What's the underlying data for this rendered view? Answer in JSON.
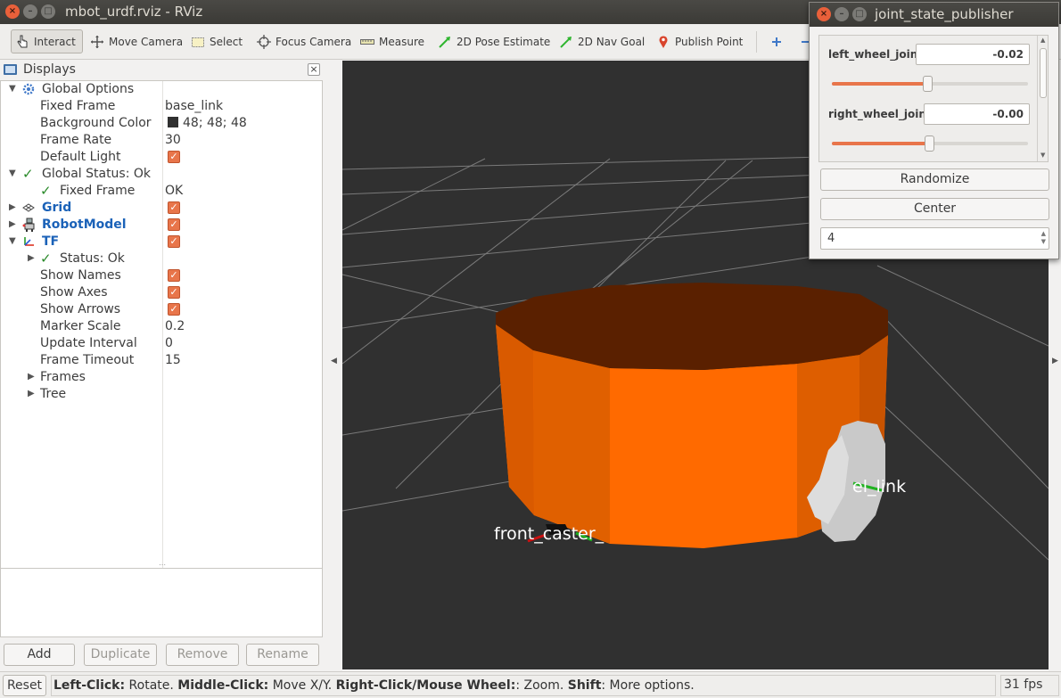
{
  "window": {
    "title": "mbot_urdf.rviz - RViz"
  },
  "toolbar": {
    "tools": [
      {
        "label": "Interact",
        "icon": "hand-pointer-icon",
        "active": true
      },
      {
        "label": "Move Camera",
        "icon": "move-camera-icon"
      },
      {
        "label": "Select",
        "icon": "select-rectangle-icon"
      },
      {
        "label": "Focus Camera",
        "icon": "focus-camera-icon"
      },
      {
        "label": "Measure",
        "icon": "ruler-icon"
      },
      {
        "label": "2D Pose Estimate",
        "icon": "pose-estimate-arrow-icon"
      },
      {
        "label": "2D Nav Goal",
        "icon": "nav-goal-arrow-icon"
      },
      {
        "label": "Publish Point",
        "icon": "map-pin-icon"
      }
    ],
    "extra_icons": [
      "add-tool-icon",
      "remove-tool-icon"
    ]
  },
  "displays": {
    "title": "Displays",
    "tree": {
      "global_options": {
        "label": "Global Options",
        "fixed_frame": {
          "label": "Fixed Frame",
          "value": "base_link"
        },
        "background_color": {
          "label": "Background Color",
          "value": "48; 48; 48",
          "swatch": "#303030"
        },
        "frame_rate": {
          "label": "Frame Rate",
          "value": "30"
        },
        "default_light": {
          "label": "Default Light",
          "checked": true
        }
      },
      "global_status": {
        "label": "Global Status: Ok",
        "fixed_frame": {
          "label": "Fixed Frame",
          "value": "OK"
        }
      },
      "grid": {
        "label": "Grid",
        "checked": true
      },
      "robot_model": {
        "label": "RobotModel",
        "checked": true
      },
      "tf": {
        "label": "TF",
        "checked": true,
        "status": {
          "label": "Status: Ok"
        },
        "show_names": {
          "label": "Show Names",
          "checked": true
        },
        "show_axes": {
          "label": "Show Axes",
          "checked": true
        },
        "show_arrows": {
          "label": "Show Arrows",
          "checked": true
        },
        "marker_scale": {
          "label": "Marker Scale",
          "value": "0.2"
        },
        "update_interval": {
          "label": "Update Interval",
          "value": "0"
        },
        "frame_timeout": {
          "label": "Frame Timeout",
          "value": "15"
        },
        "frames": {
          "label": "Frames"
        },
        "tree": {
          "label": "Tree"
        }
      }
    },
    "buttons": {
      "add": "Add",
      "duplicate": "Duplicate",
      "remove": "Remove",
      "rename": "Rename"
    }
  },
  "view3d": {
    "background": "#303030",
    "robot_color": "#ff6a00",
    "labels": {
      "front_caster": "front_caster_",
      "wheel": "el_link"
    }
  },
  "statusbar": {
    "reset": "Reset",
    "hint": {
      "left_click": "Left-Click:",
      "left_click_desc": " Rotate. ",
      "middle_click": "Middle-Click:",
      "middle_click_desc": " Move X/Y. ",
      "right_click": "Right-Click/Mouse Wheel:",
      "right_click_desc": ": Zoom. ",
      "shift": "Shift",
      "shift_desc": ": More options."
    },
    "fps": "31 fps"
  },
  "joint_state_publisher": {
    "title": "joint_state_publisher",
    "joints": [
      {
        "name": "left_wheel_joint",
        "value": "-0.02",
        "position": 0.49
      },
      {
        "name": "right_wheel_joint",
        "value": "-0.00",
        "position": 0.5
      }
    ],
    "randomize": "Randomize",
    "center": "Center",
    "spin_value": "4"
  }
}
